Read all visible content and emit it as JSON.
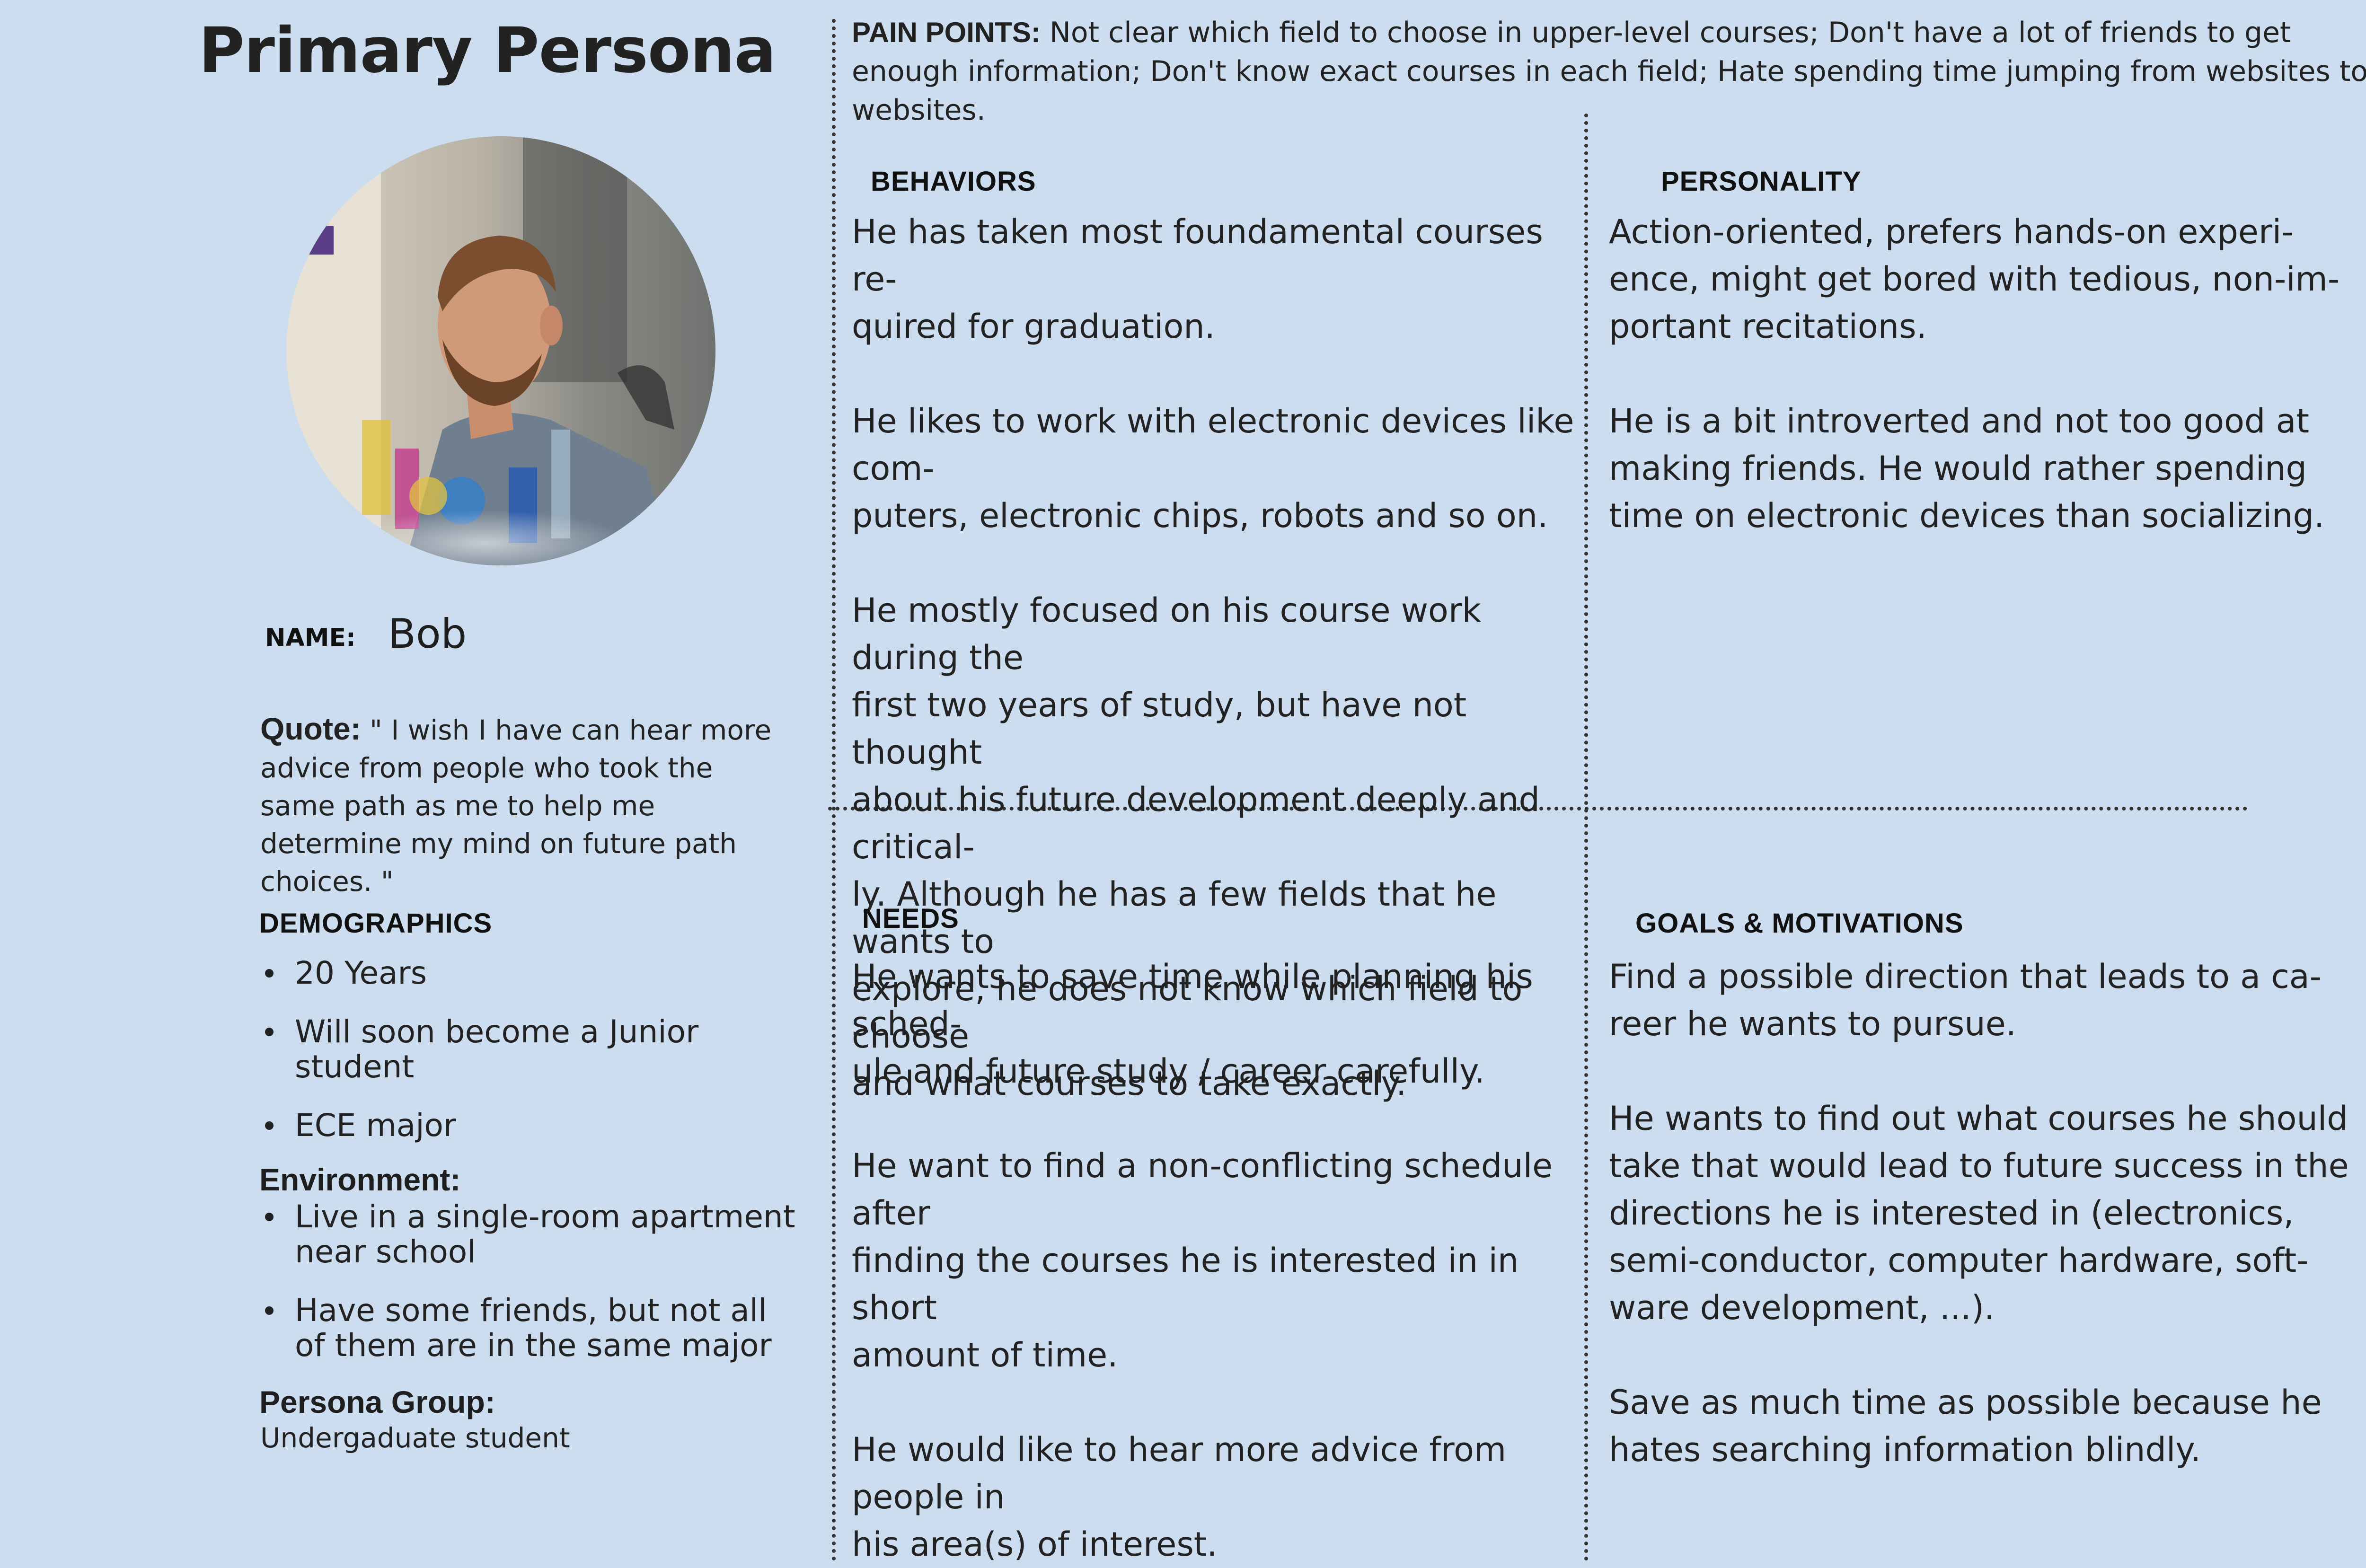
{
  "title": "Primary Persona",
  "pain_points": {
    "label": "PAIN POINTS:",
    "text": "Not clear which field to choose in upper-level courses; Don't have a lot of friends to get enough information; Don't know exact courses in each field; Hate spending time jumping from websites to websites."
  },
  "profile": {
    "name_label": "NAME:",
    "name": "Bob",
    "quote_label": "Quote:",
    "quote": "\" I wish I have can hear more advice from people who took the same path as me to help me determine my mind on future path choices. \"",
    "demographics_heading": "DEMOGRAPHICS",
    "demographics": [
      "20 Years",
      "Will soon become a Junior student",
      "ECE major"
    ],
    "environment_heading": "Environment:",
    "environment": [
      "Live in a single-room apartment near school",
      "Have some friends, but not all of them are in the same major"
    ],
    "persona_group_heading": "Persona Group:",
    "persona_group": "Undergaduate student"
  },
  "behaviors": {
    "heading": "BEHAVIORS",
    "text": "He has taken most foundamental courses re-\nquired for graduation.\n\nHe likes to work with electronic devices like com-\nputers, electronic chips, robots and so on.\n\nHe mostly focused on his course work during the\nfirst two years of study, but have not thought\nabout his future development deeply and critical-\nly. Although he has a few fields that he wants to\nexplore, he does not know which field to choose\nand what courses to take exactly."
  },
  "personality": {
    "heading": "PERSONALITY",
    "text": "Action-oriented, prefers hands-on experi-\nence, might get bored with tedious, non-im-\nportant recitations.\n\nHe is a bit introverted and not too good at\nmaking friends. He would rather spending\ntime on electronic devices than socializing."
  },
  "needs": {
    "heading": "NEEDS",
    "text": "He wants to save time while planning his sched-\nule and future study / career carefully.\n\nHe want to find a non-conflicting schedule after\nfinding the courses he is interested in in short\namount of time.\n\nHe would like to hear more advice from people in\nhis area(s) of interest."
  },
  "goals": {
    "heading": "GOALS & MOTIVATIONS",
    "text": "Find a possible direction that leads to a ca-\nreer he wants to pursue.\n\nHe wants to find out what courses he should\ntake that would lead to future success in the\ndirections he is interested in (electronics,\nsemi-conductor, computer hardware, soft-\nware development, ...).\n\nSave as much time as possible because he\nhates searching information blindly."
  }
}
